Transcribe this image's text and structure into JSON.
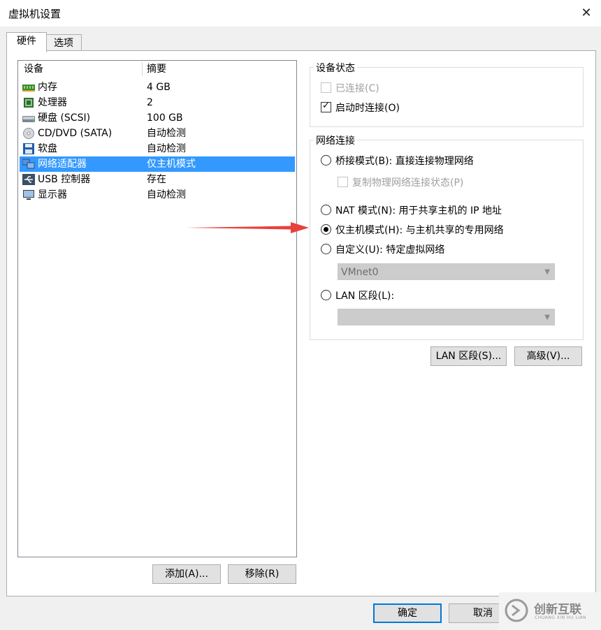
{
  "window": {
    "title": "虚拟机设置"
  },
  "tabs": [
    {
      "label": "硬件"
    },
    {
      "label": "选项"
    }
  ],
  "device_list": {
    "headers": {
      "device": "设备",
      "summary": "摘要"
    },
    "rows": [
      {
        "icon": "memory-icon",
        "name": "内存",
        "summary": "4 GB"
      },
      {
        "icon": "cpu-icon",
        "name": "处理器",
        "summary": "2"
      },
      {
        "icon": "hard-disk-icon",
        "name": "硬盘 (SCSI)",
        "summary": "100 GB"
      },
      {
        "icon": "cd-dvd-icon",
        "name": "CD/DVD (SATA)",
        "summary": "自动检测"
      },
      {
        "icon": "floppy-icon",
        "name": "软盘",
        "summary": "自动检测"
      },
      {
        "icon": "network-adapter-icon",
        "name": "网络适配器",
        "summary": "仅主机模式",
        "selected": true
      },
      {
        "icon": "usb-icon",
        "name": "USB 控制器",
        "summary": "存在"
      },
      {
        "icon": "display-icon",
        "name": "显示器",
        "summary": "自动检测"
      }
    ],
    "add_button": "添加(A)...",
    "remove_button": "移除(R)"
  },
  "device_status": {
    "title": "设备状态",
    "connected": {
      "label": "已连接(C)",
      "checked": false,
      "disabled": true
    },
    "connect_at_power_on": {
      "label": "启动时连接(O)",
      "checked": true
    }
  },
  "network_connection": {
    "title": "网络连接",
    "bridged": {
      "label": "桥接模式(B): 直接连接物理网络",
      "selected": false
    },
    "replicate": {
      "label": "复制物理网络连接状态(P)",
      "checked": false,
      "disabled": true
    },
    "nat": {
      "label": "NAT 模式(N): 用于共享主机的 IP 地址",
      "selected": false
    },
    "host_only": {
      "label": "仅主机模式(H): 与主机共享的专用网络",
      "selected": true
    },
    "custom": {
      "label": "自定义(U): 特定虚拟网络",
      "selected": false
    },
    "custom_network": {
      "value": "VMnet0",
      "disabled": true
    },
    "lan_segment": {
      "label": "LAN 区段(L):",
      "selected": false
    },
    "lan_segment_select": {
      "value": "",
      "disabled": true
    }
  },
  "buttons": {
    "lan_segments": "LAN 区段(S)...",
    "advanced": "高级(V)...",
    "ok": "确定",
    "cancel": "取消"
  },
  "annotation": {
    "arrow_color": "#e8413b"
  },
  "watermark": {
    "text": "创新互联",
    "subtext": "CHUANG XIN HU LIAN"
  },
  "colors": {
    "selection": "#3399ff",
    "accent": "#0078d7"
  }
}
